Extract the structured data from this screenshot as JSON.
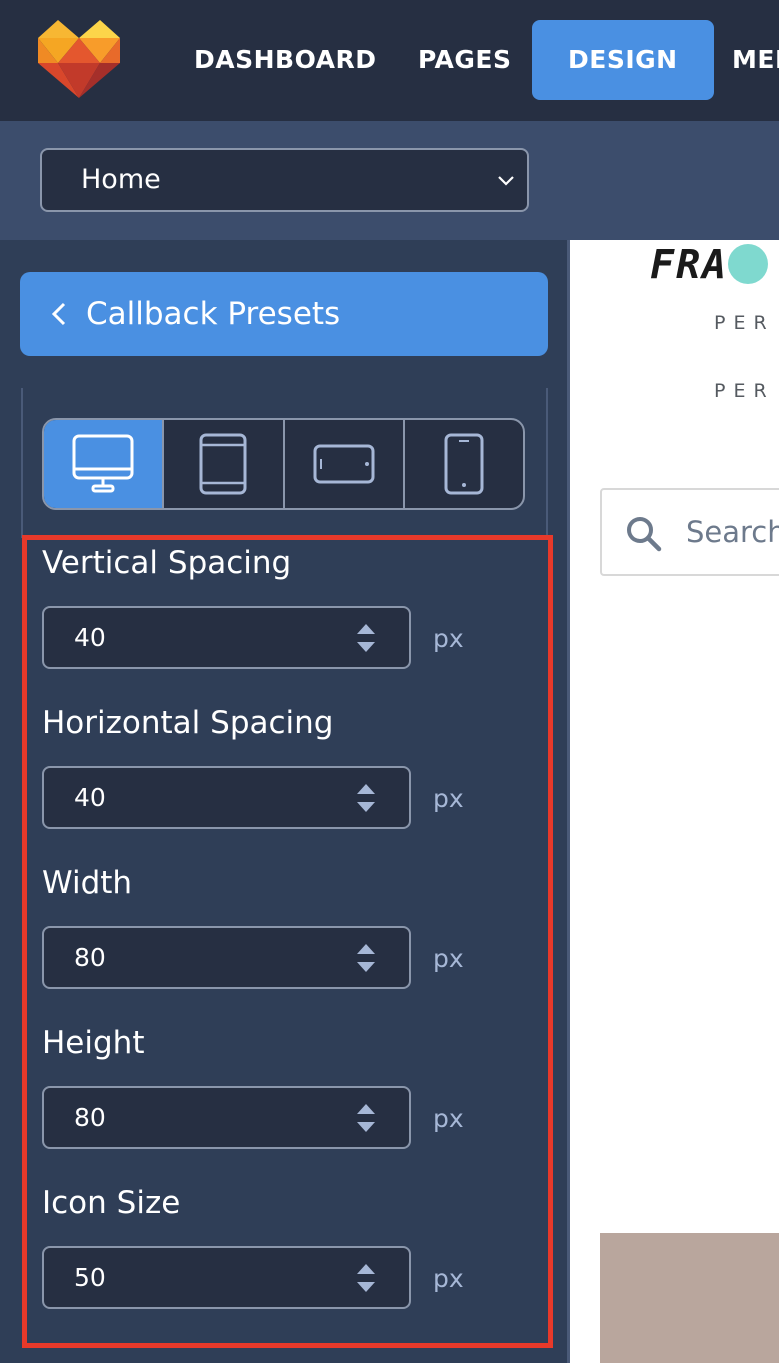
{
  "nav": {
    "items": [
      {
        "label": "DASHBOARD",
        "active": false
      },
      {
        "label": "PAGES",
        "active": false
      },
      {
        "label": "DESIGN",
        "active": true
      },
      {
        "label": "MED",
        "active": false
      }
    ]
  },
  "page_select": {
    "value": "Home"
  },
  "panel": {
    "back_label": "Callback Presets",
    "devices": [
      {
        "name": "desktop",
        "active": true
      },
      {
        "name": "tablet-portrait",
        "active": false
      },
      {
        "name": "tablet-landscape",
        "active": false
      },
      {
        "name": "mobile",
        "active": false
      }
    ],
    "fields": [
      {
        "label": "Vertical Spacing",
        "value": "40",
        "unit": "px"
      },
      {
        "label": "Horizontal Spacing",
        "value": "40",
        "unit": "px"
      },
      {
        "label": "Width",
        "value": "80",
        "unit": "px"
      },
      {
        "label": "Height",
        "value": "80",
        "unit": "px"
      },
      {
        "label": "Icon Size",
        "value": "50",
        "unit": "px"
      }
    ]
  },
  "preview": {
    "brand_prefix": "FRA",
    "tagline_1": "PER",
    "tagline_2": "PER",
    "search_placeholder": "Search"
  },
  "colors": {
    "accent": "#4a90e2",
    "nav_bg": "#262f42",
    "panel_bg": "#2f3e57",
    "highlight": "#e8392a"
  }
}
